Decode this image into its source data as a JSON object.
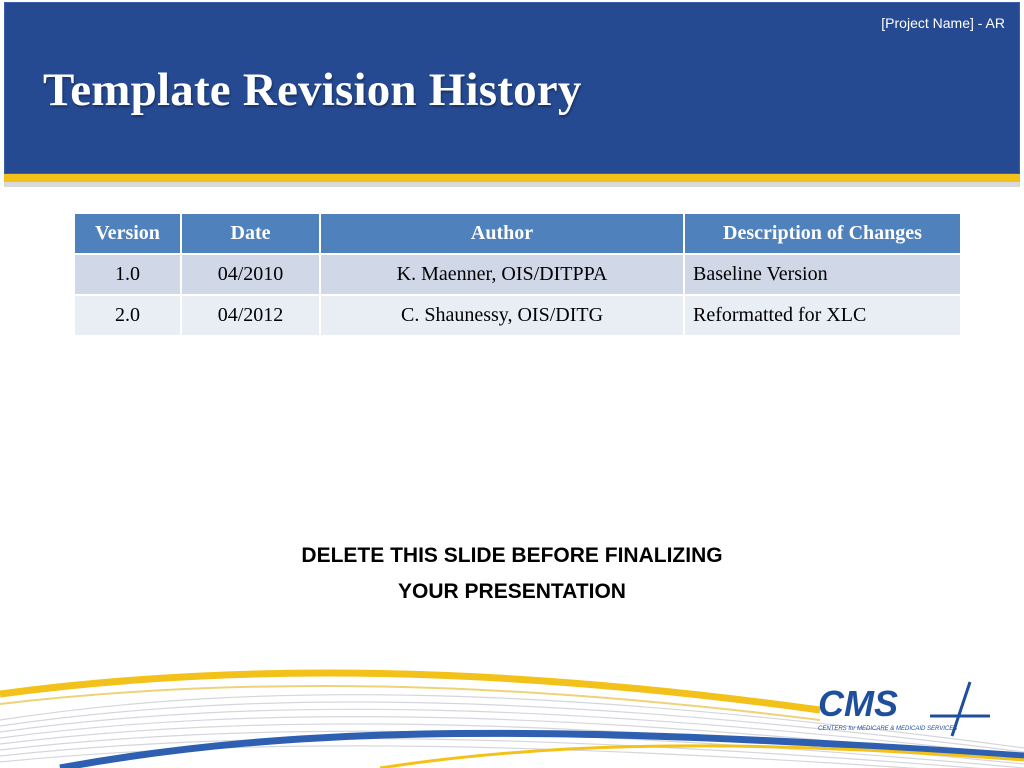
{
  "header": {
    "project_tag": "[Project Name] - AR",
    "title": "Template Revision History"
  },
  "table": {
    "columns": [
      "Version",
      "Date",
      "Author",
      "Description of Changes"
    ],
    "rows": [
      {
        "version": "1.0",
        "date": "04/2010",
        "author": "K. Maenner, OIS/DITPPA",
        "description": "Baseline Version"
      },
      {
        "version": "2.0",
        "date": "04/2012",
        "author": "C. Shaunessy, OIS/DITG",
        "description": "Reformatted for XLC"
      }
    ]
  },
  "notice": {
    "line1": "DELETE THIS SLIDE BEFORE FINALIZING",
    "line2": "YOUR PRESENTATION"
  },
  "logo": {
    "wordmark": "CMS",
    "subtitle": "CENTERS for MEDICARE & MEDICAID SERVICES"
  },
  "colors": {
    "header_blue": "#264a92",
    "gold": "#f2c21a",
    "table_header": "#4f81bd",
    "row_odd": "#d0d8e8",
    "row_even": "#e9edf4",
    "logo_blue": "#1f4e9c"
  }
}
